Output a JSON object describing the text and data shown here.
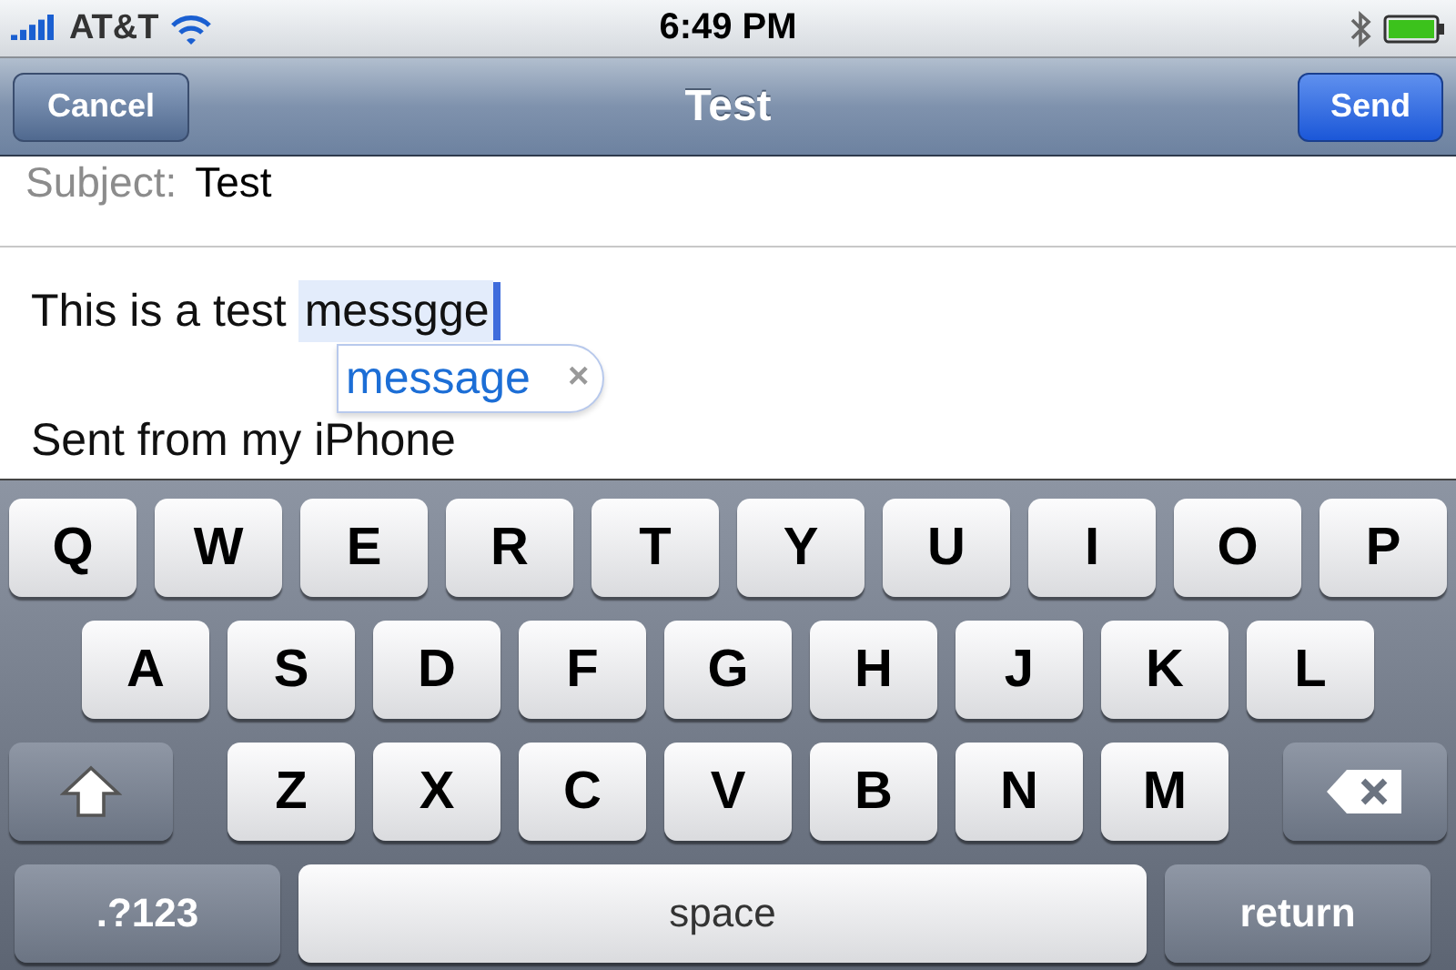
{
  "status_bar": {
    "carrier": "AT&T",
    "time": "6:49 PM"
  },
  "nav_bar": {
    "left_button": "Cancel",
    "title": "Test",
    "right_button": "Send"
  },
  "subject": {
    "label": "Subject:",
    "value": "Test"
  },
  "body": {
    "text_before": "This is a test",
    "misspelled_word": "messgge",
    "suggestion": "message",
    "dismiss": "×",
    "signature": "Sent from my iPhone"
  },
  "keyboard": {
    "key_rows": [
      {
        "keys": [
          {
            "kind": "letter",
            "label": "Q"
          },
          {
            "kind": "letter",
            "label": "W"
          },
          {
            "kind": "letter",
            "label": "E"
          },
          {
            "kind": "letter",
            "label": "R"
          },
          {
            "kind": "letter",
            "label": "T"
          },
          {
            "kind": "letter",
            "label": "Y"
          },
          {
            "kind": "letter",
            "label": "U"
          },
          {
            "kind": "letter",
            "label": "I"
          },
          {
            "kind": "letter",
            "label": "O"
          },
          {
            "kind": "letter",
            "label": "P"
          }
        ]
      },
      {
        "keys": [
          {
            "kind": "letter",
            "label": "A"
          },
          {
            "kind": "letter",
            "label": "S"
          },
          {
            "kind": "letter",
            "label": "D"
          },
          {
            "kind": "letter",
            "label": "F"
          },
          {
            "kind": "letter",
            "label": "G"
          },
          {
            "kind": "letter",
            "label": "H"
          },
          {
            "kind": "letter",
            "label": "J"
          },
          {
            "kind": "letter",
            "label": "K"
          },
          {
            "kind": "letter",
            "label": "L"
          }
        ]
      },
      {
        "keys": [
          {
            "kind": "shift"
          },
          {
            "kind": "letter",
            "label": "Z"
          },
          {
            "kind": "letter",
            "label": "X"
          },
          {
            "kind": "letter",
            "label": "C"
          },
          {
            "kind": "letter",
            "label": "V"
          },
          {
            "kind": "letter",
            "label": "B"
          },
          {
            "kind": "letter",
            "label": "N"
          },
          {
            "kind": "letter",
            "label": "M"
          },
          {
            "kind": "delete"
          }
        ]
      },
      {
        "keys": [
          {
            "kind": "mode",
            "label": ".?123"
          },
          {
            "kind": "space",
            "label": "space"
          },
          {
            "kind": "return",
            "label": "return"
          }
        ]
      }
    ]
  }
}
